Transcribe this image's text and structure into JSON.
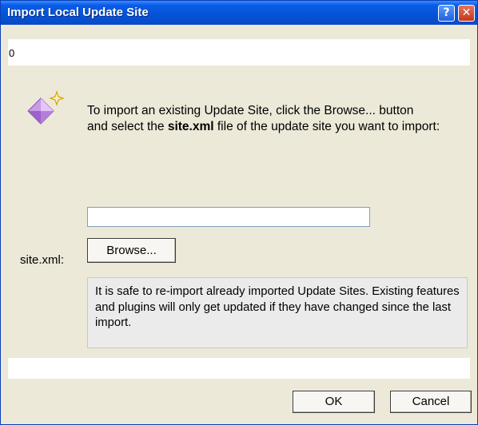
{
  "window": {
    "title": "Import Local Update Site",
    "help_glyph": "?",
    "close_glyph": "✕"
  },
  "message_strip": {
    "text": "0"
  },
  "wizard": {
    "icon": "wizard-gem-icon",
    "intro_line1": "To import an existing Update Site, click the Browse... button",
    "intro_line2_prefix": "and select the ",
    "intro_line2_bold": "site.xml",
    "intro_line2_suffix": " file of the update site you want to import:"
  },
  "form": {
    "site_label": "site.xml:",
    "site_value": "",
    "browse_label": "Browse..."
  },
  "info": {
    "text": "It is safe to re-import already imported Update Sites. Existing features and plugins will only get updated if they have changed since the last import."
  },
  "footer": {
    "ok_label": "OK",
    "cancel_label": "Cancel"
  },
  "colors": {
    "titlebar": "#0453d6",
    "dialog_bg": "#ece9d8",
    "info_bg": "#ebebeb",
    "gem": "#b07ad8"
  }
}
